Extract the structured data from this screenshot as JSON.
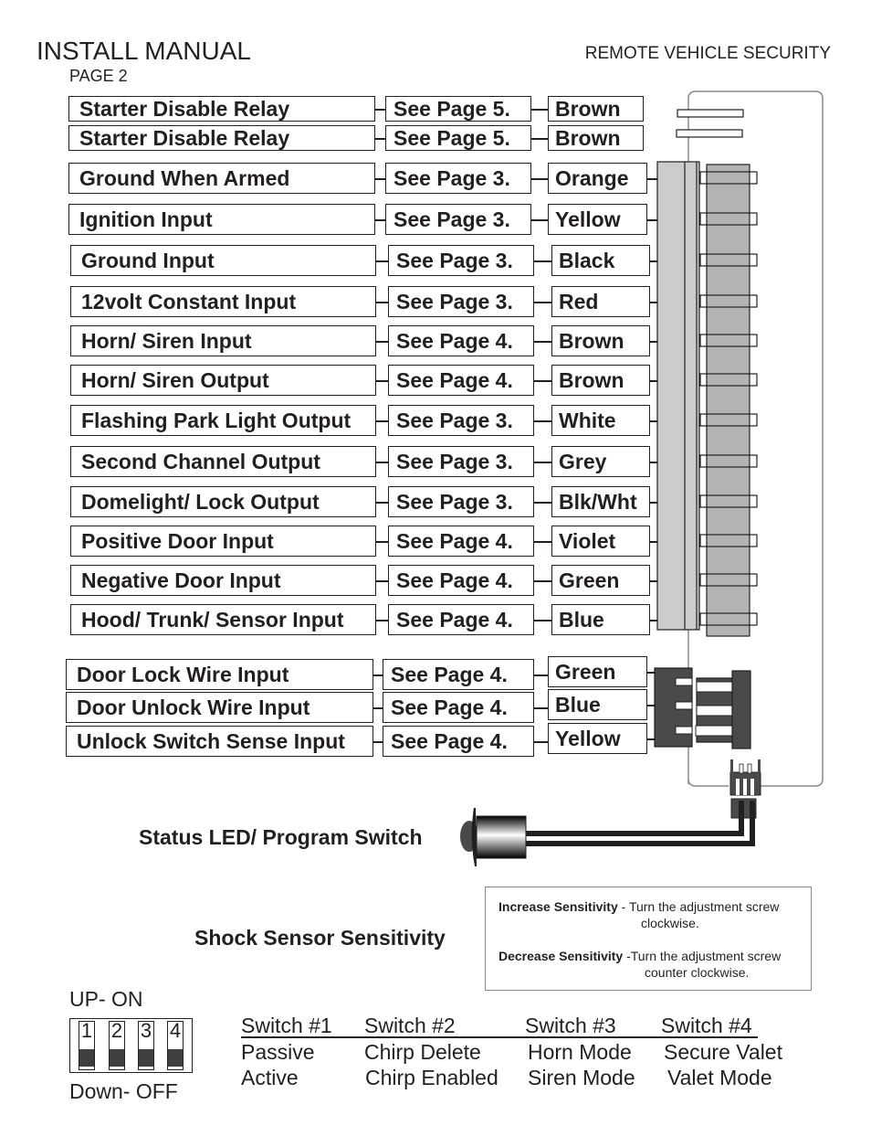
{
  "header": {
    "title": "INSTALL MANUAL",
    "page": "PAGE 2",
    "product": "REMOTE VEHICLE SECURITY"
  },
  "wires": [
    {
      "function": "Starter Disable Relay",
      "reference": "See Page 5.",
      "color": "Brown"
    },
    {
      "function": "Starter Disable Relay",
      "reference": "See Page 5.",
      "color": "Brown"
    },
    {
      "function": "Ground When Armed",
      "reference": "See Page 3.",
      "color": "Orange"
    },
    {
      "function": "Ignition Input",
      "reference": "See Page 3.",
      "color": "Yellow"
    },
    {
      "function": "Ground Input",
      "reference": "See Page 3.",
      "color": "Black"
    },
    {
      "function": "12volt Constant Input",
      "reference": "See Page 3.",
      "color": "Red"
    },
    {
      "function": "Horn/ Siren Input",
      "reference": "See Page 4.",
      "color": "Brown"
    },
    {
      "function": "Horn/ Siren Output",
      "reference": "See Page 4.",
      "color": "Brown"
    },
    {
      "function": "Flashing Park Light Output",
      "reference": "See Page 3.",
      "color": "White"
    },
    {
      "function": "Second Channel Output",
      "reference": "See Page 3.",
      "color": "Grey"
    },
    {
      "function": "Domelight/ Lock Output",
      "reference": "See Page 3.",
      "color": "Blk/Wht"
    },
    {
      "function": "Positive Door Input",
      "reference": "See Page 4.",
      "color": "Violet"
    },
    {
      "function": "Negative Door Input",
      "reference": "See Page 4.",
      "color": "Green"
    },
    {
      "function": "Hood/ Trunk/ Sensor Input",
      "reference": "See Page 4.",
      "color": "Blue"
    }
  ],
  "lock_wires": [
    {
      "function": "Door Lock Wire Input",
      "reference": "See Page 4.",
      "color": "Green"
    },
    {
      "function": "Door Unlock Wire Input",
      "reference": "See Page 4.",
      "color": "Blue"
    },
    {
      "function": "Unlock Switch Sense Input",
      "reference": "See Page 4.",
      "color": "Yellow"
    }
  ],
  "led": {
    "label": "Status LED/ Program Switch"
  },
  "shock_sensor": {
    "label": "Shock Sensor Sensitivity",
    "increase_title": "Increase Sensitivity",
    "increase_text_1": " - Turn the adjustment screw",
    "increase_text_2": "clockwise.",
    "decrease_title": "Decrease Sensitivity",
    "decrease_text_1": " -Turn the adjustment screw",
    "decrease_text_2": "counter clockwise."
  },
  "dip_switch": {
    "up_label": "UP- ON",
    "down_label": "Down- OFF",
    "switches": [
      {
        "number": "1",
        "position": "down"
      },
      {
        "number": "2",
        "position": "down"
      },
      {
        "number": "3",
        "position": "down"
      },
      {
        "number": "4",
        "position": "down"
      }
    ]
  },
  "switch_table": {
    "headers": [
      "Switch #1",
      "Switch #2",
      "Switch #3",
      "Switch #4"
    ],
    "on_row": [
      "Passive",
      "Chirp Delete",
      "Horn Mode",
      "Secure Valet"
    ],
    "off_row": [
      "Active",
      "Chirp Enabled",
      "Siren Mode",
      "Valet Mode"
    ]
  },
  "colors": {
    "ink": "#231f20",
    "connector_light": "#cccccc",
    "connector_mid": "#b3b3b3",
    "connector_dark": "#4a4a4a",
    "frame": "#8a8a8a"
  }
}
